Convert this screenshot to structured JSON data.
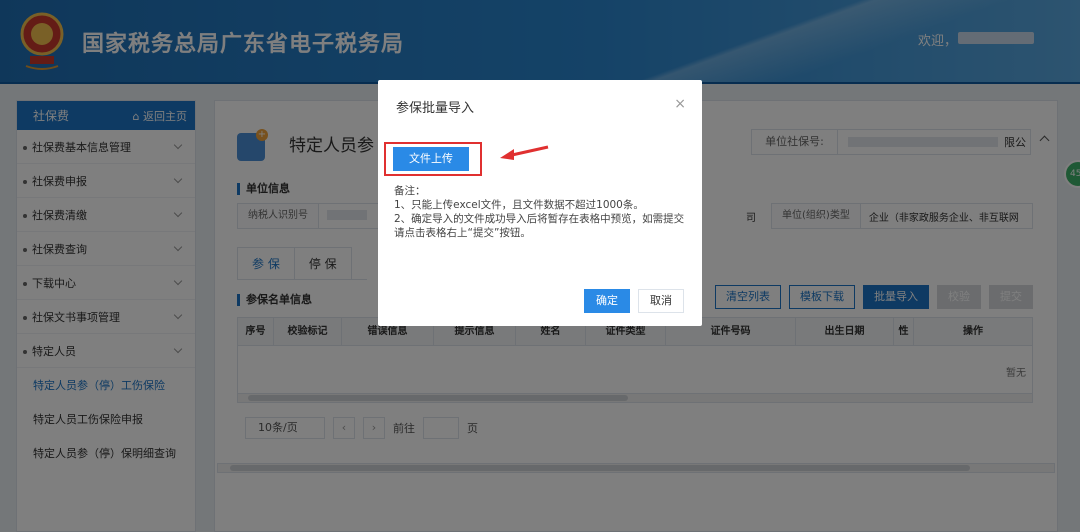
{
  "header": {
    "title": "国家税务总局广东省电子税务局",
    "welcome": "欢迎，"
  },
  "sidebar": {
    "title": "社保费",
    "home": "返回主页",
    "items": [
      {
        "label": "社保费基本信息管理"
      },
      {
        "label": "社保费申报"
      },
      {
        "label": "社保费清缴"
      },
      {
        "label": "社保费查询"
      },
      {
        "label": "下载中心"
      },
      {
        "label": "社保文书事项管理"
      },
      {
        "label": "特定人员"
      }
    ],
    "sub_items": [
      {
        "label": "特定人员参（停）工伤保险"
      },
      {
        "label": "特定人员工伤保险申报"
      },
      {
        "label": "特定人员参（停）保明细查询"
      }
    ]
  },
  "main": {
    "title": "特定人员参",
    "unit_no_label": "单位社保号:",
    "unit_no_tail": "限公",
    "unit_info_title": "单位信息",
    "taxpayer_id_label": "纳税人识别号",
    "company_name_tail": "司",
    "org_type_label": "单位(组织)类型",
    "org_type_value": "企业（非家政服务企业、非互联网",
    "tabs": [
      "参 保",
      "停 保"
    ],
    "list_title": "参保名单信息",
    "buttons": {
      "clear": "清空列表",
      "template": "模板下载",
      "batch": "批量导入",
      "check": "校验",
      "submit": "提交"
    },
    "columns": [
      "序号",
      "校验标记",
      "错误信息",
      "提示信息",
      "姓名",
      "证件类型",
      "证件号码",
      "出生日期",
      "性",
      "操作"
    ],
    "empty_text": "暂无",
    "pager": {
      "size": "10条/页",
      "goto": "前往",
      "page": "页"
    }
  },
  "badge": "45",
  "dialog": {
    "title": "参保批量导入",
    "close": "×",
    "upload": "文件上传",
    "note_title": "备注：",
    "note1": "1、只能上传excel文件，且文件数据不超过1000条。",
    "note2": "2、确定导入的文件成功导入后将暂存在表格中预览，如需提交请点击表格右上“提交”按钮。",
    "ok": "确定",
    "cancel": "取消"
  },
  "colors": {
    "brand": "#1c75c6",
    "primary_button": "#2a8ae6",
    "highlight": "#e03030"
  }
}
